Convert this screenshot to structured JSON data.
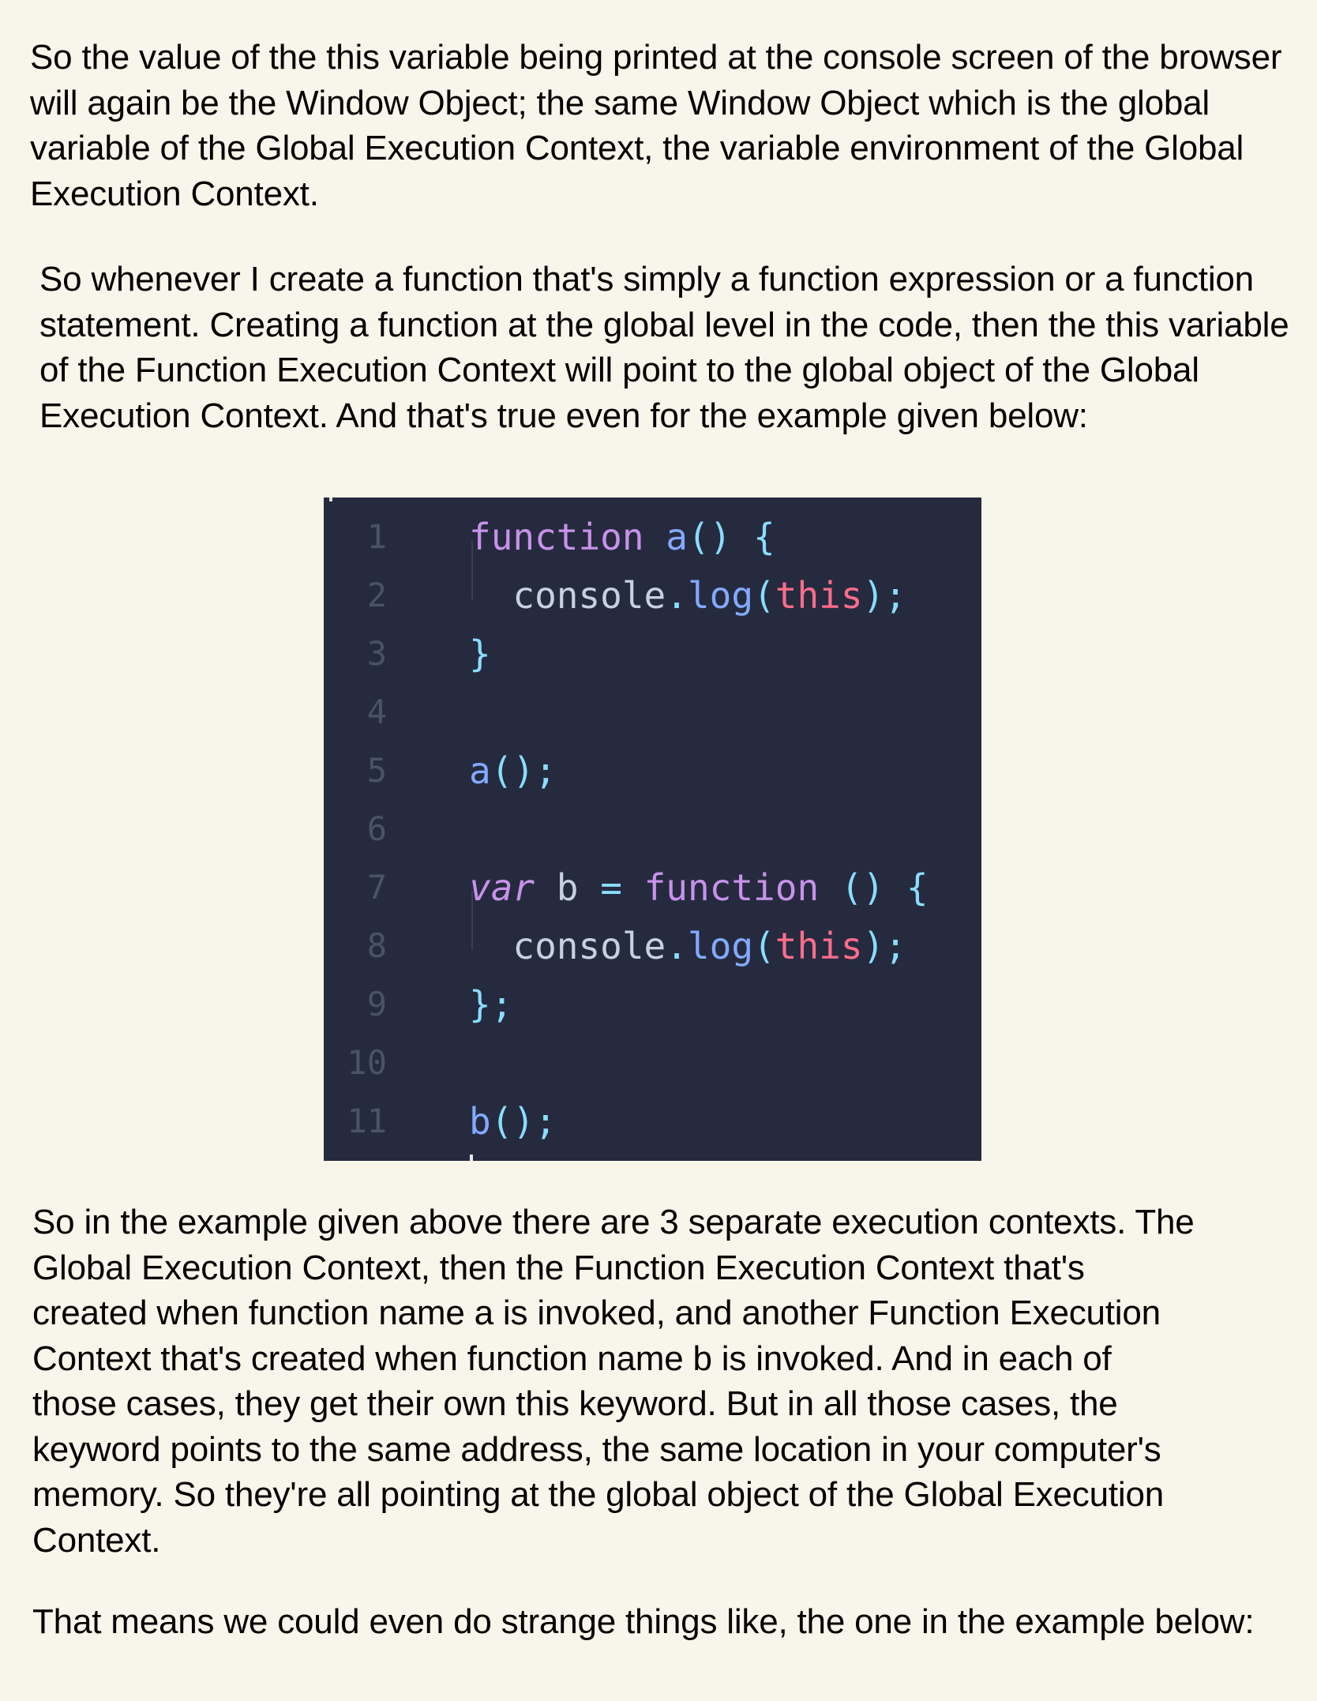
{
  "paragraphs": {
    "p1": "So the value of the this variable being printed at the console screen of the browser will again be the Window Object; the same Window Object which is the global variable of the Global Execution Context, the variable environment of the Global Execution Context.",
    "p2": "So whenever I create a function that's simply a function expression or a function statement. Creating a function at the global level in the code, then the this variable of the Function Execution Context will point to the global object of the Global Execution Context. And that's true even for the example given below:",
    "p3_lines": [
      "So in the example given above there are 3 separate execution contexts. The",
      "Global Execution Context, then the Function Execution Context that's",
      "created when function name a is invoked, and another Function Execution",
      "Context that's created when function name b is invoked. And in each of",
      "those cases, they get their own this keyword. But in all those cases, the",
      "keyword points to the same address, the same location in your computer's",
      "memory. So they're all pointing at the global object of the Global Execution",
      "Context."
    ],
    "p4": "That means we could even do strange things like, the one in the example below:"
  },
  "code": {
    "line_numbers": [
      "1",
      "2",
      "3",
      "4",
      "5",
      "6",
      "7",
      "8",
      "9",
      "10",
      "11"
    ],
    "lines": [
      [
        {
          "t": "function",
          "c": "kw-fn"
        },
        {
          "t": " a",
          "c": "fn-name"
        },
        {
          "t": "()",
          "c": "punc"
        },
        {
          "t": " {",
          "c": "punc"
        }
      ],
      [
        {
          "t": "  console",
          "c": "plain"
        },
        {
          "t": ".",
          "c": "punc"
        },
        {
          "t": "log",
          "c": "fn-name"
        },
        {
          "t": "(",
          "c": "punc"
        },
        {
          "t": "this",
          "c": "this"
        },
        {
          "t": ");",
          "c": "punc"
        }
      ],
      [
        {
          "t": "}",
          "c": "punc"
        }
      ],
      [],
      [
        {
          "t": "a",
          "c": "fn-name"
        },
        {
          "t": "();",
          "c": "punc"
        }
      ],
      [],
      [
        {
          "t": "var",
          "c": "kw-var"
        },
        {
          "t": " b ",
          "c": "plain"
        },
        {
          "t": "=",
          "c": "punc"
        },
        {
          "t": " function",
          "c": "kw-fn"
        },
        {
          "t": " ()",
          "c": "punc"
        },
        {
          "t": " {",
          "c": "punc"
        }
      ],
      [
        {
          "t": "  console",
          "c": "plain"
        },
        {
          "t": ".",
          "c": "punc"
        },
        {
          "t": "log",
          "c": "fn-name"
        },
        {
          "t": "(",
          "c": "punc"
        },
        {
          "t": "this",
          "c": "this"
        },
        {
          "t": ");",
          "c": "punc"
        }
      ],
      [
        {
          "t": "};",
          "c": "punc"
        }
      ],
      [],
      [
        {
          "t": "b",
          "c": "fn-name"
        },
        {
          "t": "();",
          "c": "punc"
        }
      ]
    ]
  },
  "colors": {
    "page_background": "#f8f6ea",
    "editor_background": "#262a3f",
    "keyword": "#c792ea",
    "function_name": "#82aaff",
    "punctuation": "#89ddff",
    "this_keyword": "#ff6d8a",
    "line_number": "#4b5169"
  }
}
